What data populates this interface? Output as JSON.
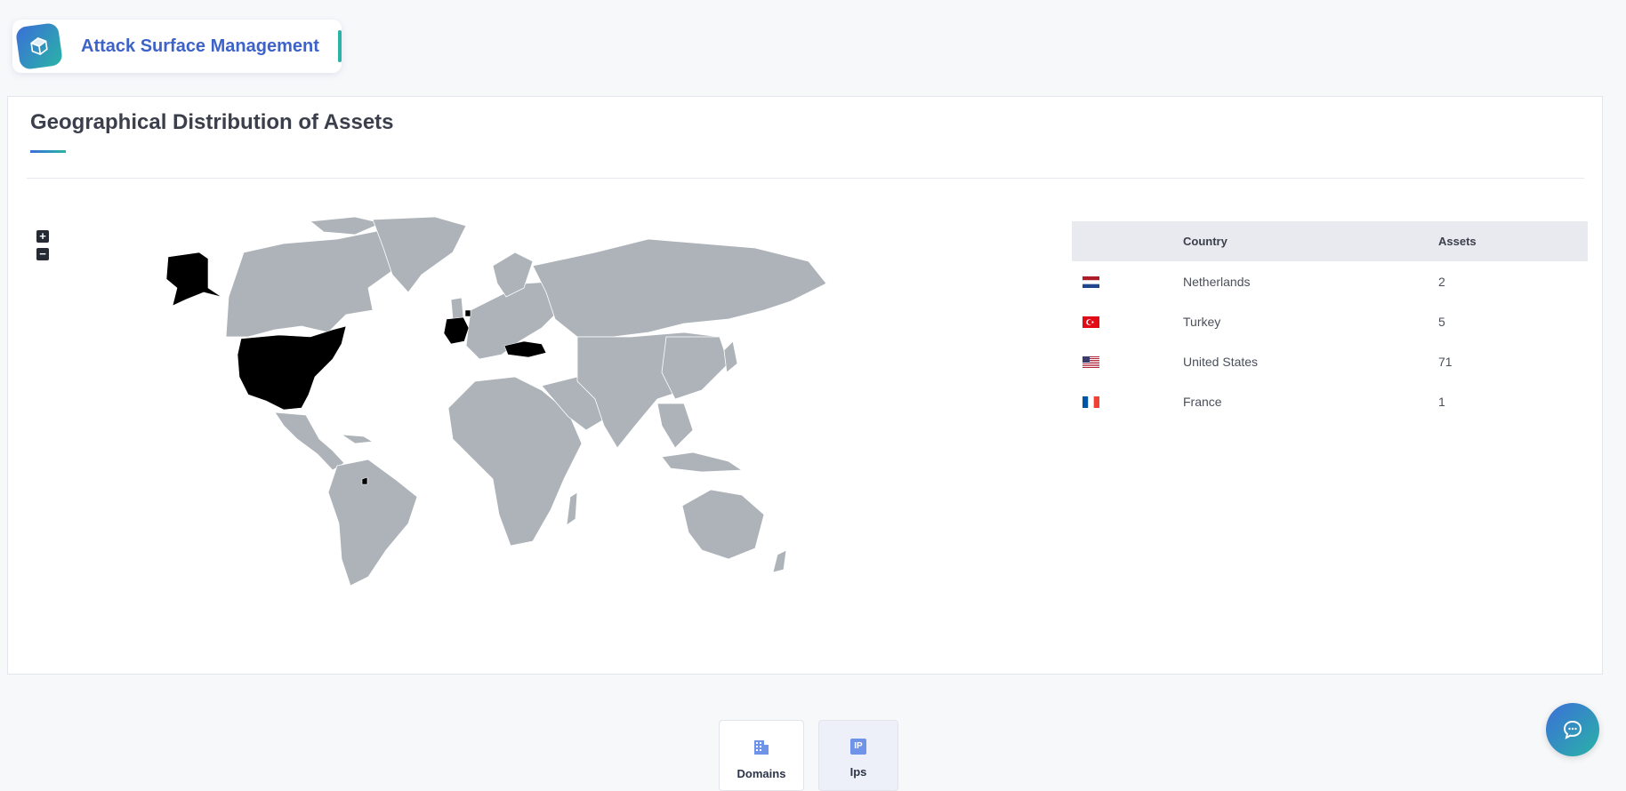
{
  "brand": {
    "title": "Attack Surface Management"
  },
  "card": {
    "title": "Geographical Distribution of Assets"
  },
  "map": {
    "zoom_in_label": "+",
    "zoom_out_label": "−",
    "base_color": "#adb3b8",
    "highlight_color": "#000000",
    "highlighted_countries": [
      "United States",
      "Alaska",
      "France",
      "Netherlands",
      "Turkey"
    ]
  },
  "table": {
    "headers": {
      "flag": "",
      "country": "Country",
      "assets": "Assets"
    },
    "rows": [
      {
        "flag": "netherlands-flag",
        "country": "Netherlands",
        "assets": "2"
      },
      {
        "flag": "turkey-flag",
        "country": "Turkey",
        "assets": "5"
      },
      {
        "flag": "united-states-flag",
        "country": "United States",
        "assets": "71"
      },
      {
        "flag": "france-flag",
        "country": "France",
        "assets": "1"
      }
    ]
  },
  "tabs": [
    {
      "icon": "building-icon",
      "label": "Domains"
    },
    {
      "icon": "ip-icon",
      "icon_text": "IP",
      "label": "Ips"
    }
  ],
  "colors": {
    "accent": "#3d63c9",
    "accent_teal": "#2ab3a6",
    "header_bg": "#e9e9f0"
  }
}
